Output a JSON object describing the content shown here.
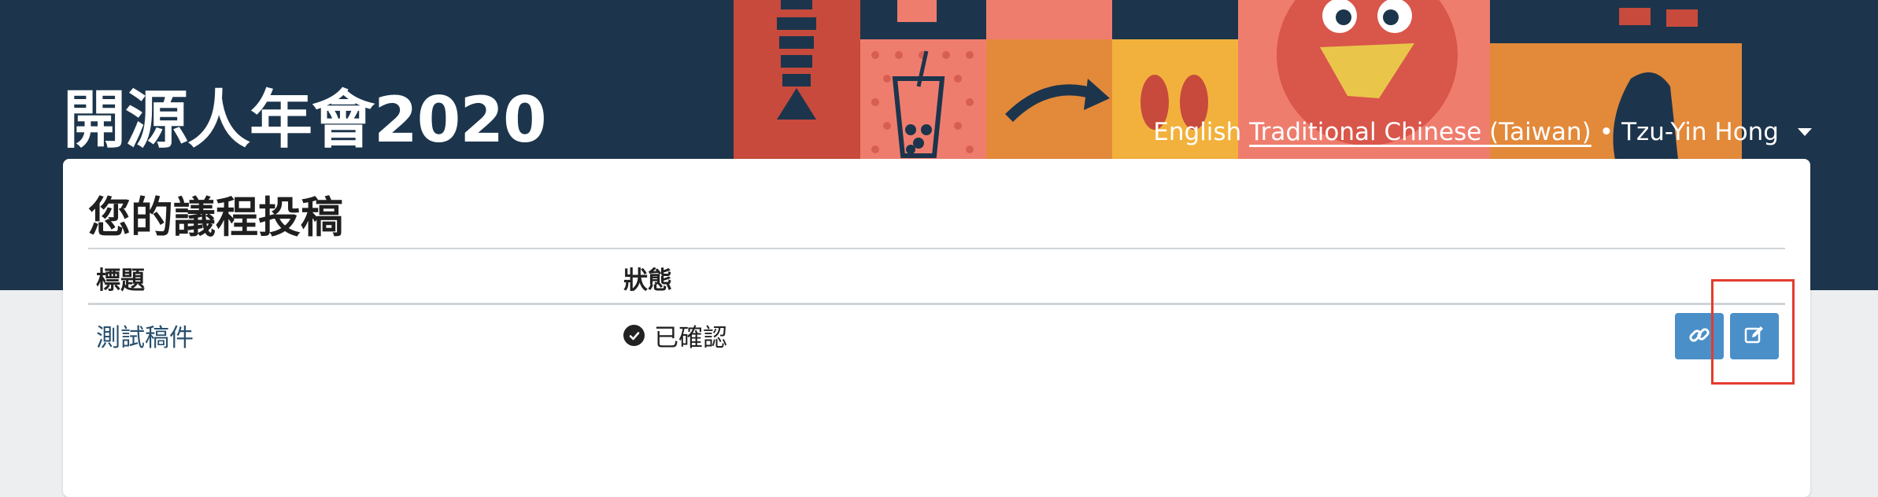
{
  "header": {
    "conference_title": "開源人年會2020",
    "nav": {
      "lang_other": "English",
      "lang_current": "Traditional Chinese (Taiwan)",
      "separator": "•",
      "user_name": "Tzu-Yin Hong"
    }
  },
  "card": {
    "title": "您的議程投稿",
    "columns": [
      "標題",
      "狀態"
    ],
    "rows": [
      {
        "title": "測試稿件",
        "status": "已確認"
      }
    ]
  },
  "colors": {
    "header_bg": "#1c354c",
    "button": "#4a8fc8",
    "highlight": "#e33b2e",
    "link": "#28506e"
  },
  "icons": [
    "link-icon",
    "edit-icon",
    "check-circle-icon",
    "caret-down-icon"
  ]
}
